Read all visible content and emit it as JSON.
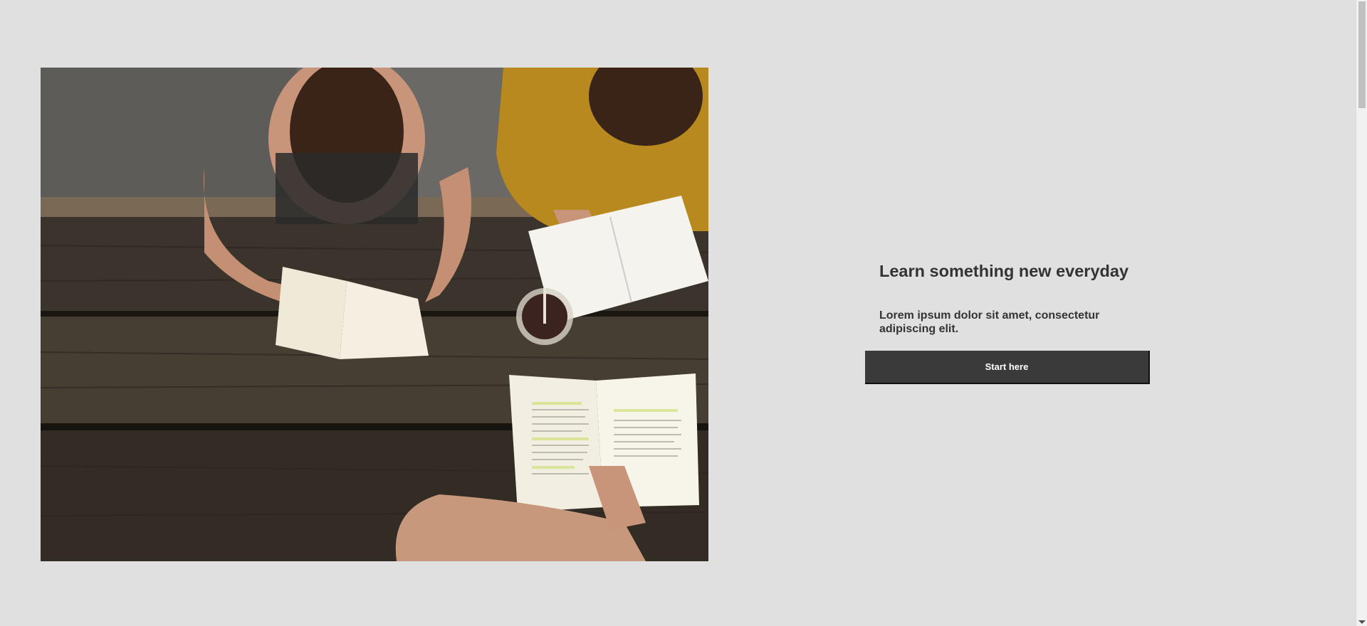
{
  "hero": {
    "image_description_icon": "photo-students-reading-at-table"
  },
  "content": {
    "headline": "Learn something new everyday",
    "description": "Lorem ipsum dolor sit amet, consectetur adipiscing elit.",
    "cta_label": "Start here"
  },
  "colors": {
    "background": "#e0e0e0",
    "button": "#3a3a3a",
    "button_text": "#ffffff",
    "text": "#333333"
  }
}
